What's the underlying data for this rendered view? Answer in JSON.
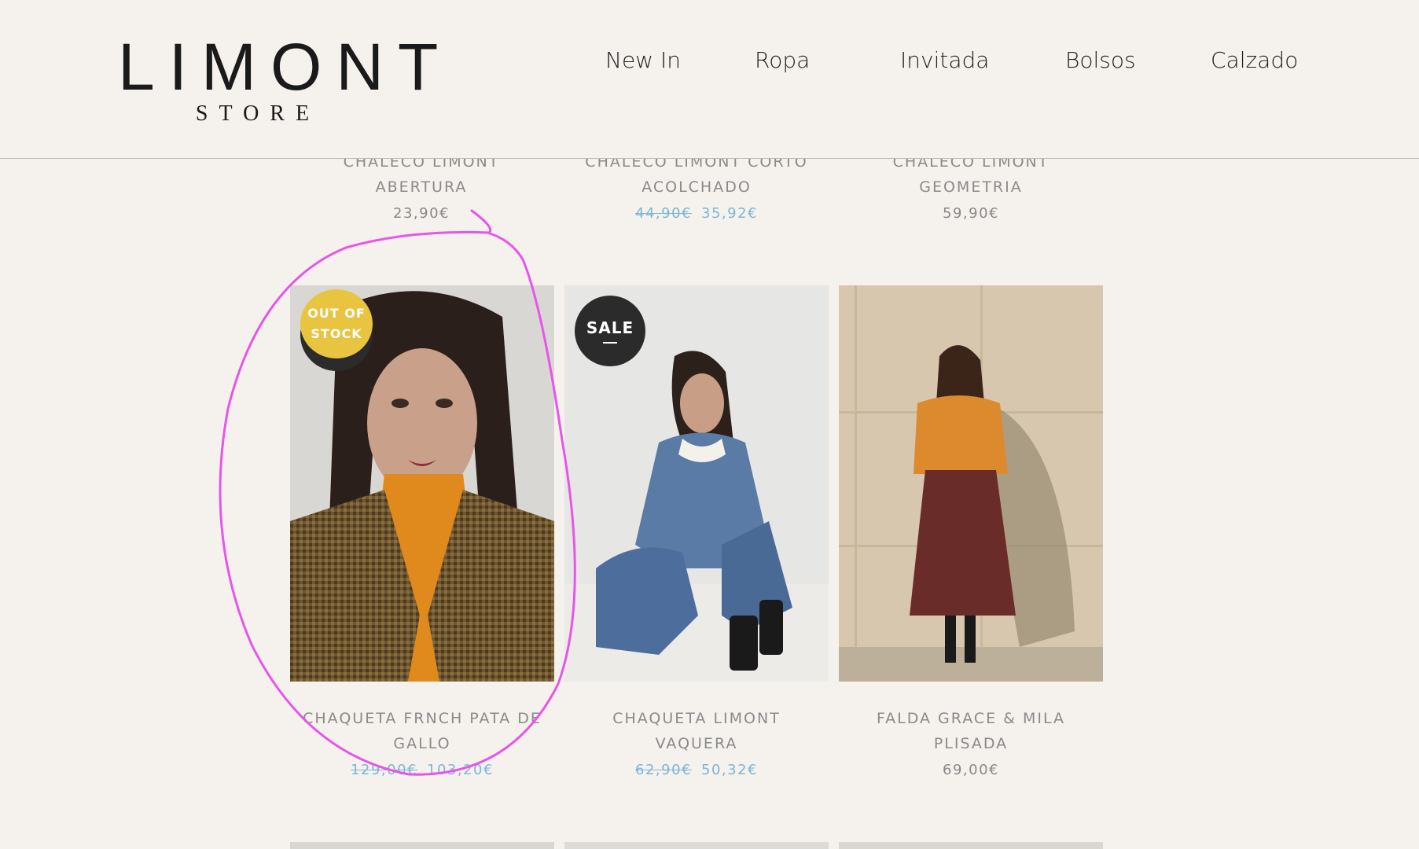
{
  "header": {
    "logo_main": "LIMONT",
    "logo_sub": "STORE",
    "nav": [
      "New In",
      "Ropa",
      "Invitada",
      "Bolsos",
      "Calzado"
    ]
  },
  "top_row": [
    {
      "name_line1": "CHALECO LIMONT",
      "name_line2": "ABERTURA",
      "price": "23,90€"
    },
    {
      "name_line1": "CHALECO LIMONT CORTO",
      "name_line2": "ACOLCHADO",
      "old_price": "44,90€",
      "sale_price": "35,92€"
    },
    {
      "name_line1": "CHALECO LIMONT",
      "name_line2": "GEOMETRIA",
      "price": "59,90€"
    }
  ],
  "products": [
    {
      "name_line1": "CHAQUETA FRNCH PATA DE",
      "name_line2": "GALLO",
      "old_price": "129,00€",
      "sale_price": "103,20€",
      "badge_line1": "OUT OF",
      "badge_line2": "STOCK"
    },
    {
      "name_line1": "CHAQUETA LIMONT",
      "name_line2": "VAQUERA",
      "old_price": "62,90€",
      "sale_price": "50,32€",
      "badge": "SALE"
    },
    {
      "name_line1": "FALDA GRACE & MILA",
      "name_line2": "PLISADA",
      "price": "69,00€"
    }
  ],
  "colors": {
    "background": "#f5f2ee",
    "sale_price": "#7db5d6",
    "out_of_stock_badge": "#e8c440",
    "sale_badge": "#2b2b2b",
    "annotation": "#e855e8"
  }
}
